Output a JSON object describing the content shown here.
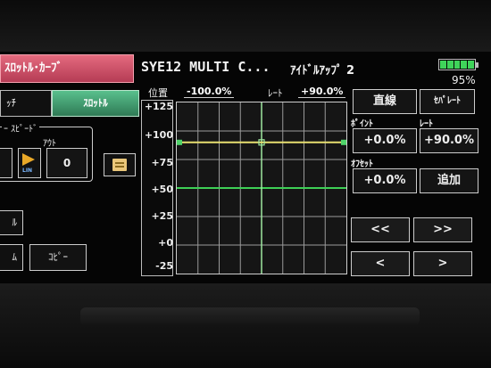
{
  "header": {
    "screen_title": "ｽﾛｯﾄﾙ･ｶｰﾌﾞ",
    "model_name": "SYE12 MULTI C...",
    "condition": "ｱｲﾄﾞﾙｱｯﾌﾟ 2",
    "battery_percent": "95%",
    "battery_level": 0.95
  },
  "tabs": [
    {
      "label": "ｯﾁ"
    },
    {
      "label": "ｽﾛｯﾄﾙ",
      "active": true
    }
  ],
  "speed": {
    "label": "ｰ ｽﾋﾟｰﾄﾞ",
    "out_label": "ｱｳﾄ",
    "lin_label": "LIN",
    "out_value": "0"
  },
  "left_buttons": {
    "mix_label": "ﾙ",
    "ch_label": "ﾑ",
    "copy_label": "ｺﾋﾟｰ"
  },
  "curve": {
    "position_label": "位置",
    "position_value": "-100.0%",
    "rate_label": "ﾚｰﾄ",
    "rate_value": "+90.0%",
    "y_ticks": [
      "+125",
      "+100",
      "+75",
      "+50",
      "+25",
      "+0",
      "-25"
    ]
  },
  "right_panel": {
    "linear_label": "直線",
    "separate_label": "ｾﾊﾟﾚｰﾄ",
    "point_label": "ﾎﾟｲﾝﾄ",
    "point_value": "+0.0%",
    "rate_label": "ﾚｰﾄ",
    "rate_value": "+90.0%",
    "offset_label": "ｵﾌｾｯﾄ",
    "offset_value": "+0.0%",
    "add_label": "追加",
    "nav_far_prev": "<<",
    "nav_far_next": ">>",
    "nav_prev": "<",
    "nav_next": ">"
  },
  "chart_data": {
    "type": "line",
    "y_range": [
      -25,
      125
    ],
    "x_range": [
      -100,
      100
    ],
    "series": [
      {
        "x": [
          -100,
          100
        ],
        "y": [
          90,
          90
        ]
      }
    ],
    "reference_line_y": 50,
    "cursor_x": 0,
    "grid": true
  },
  "colors": {
    "title_bg": "#c94a62",
    "tab_active": "#3f9a6c",
    "curve": "#e8e070",
    "reference": "#3ecf56",
    "cursor": "#9fe8a0"
  }
}
